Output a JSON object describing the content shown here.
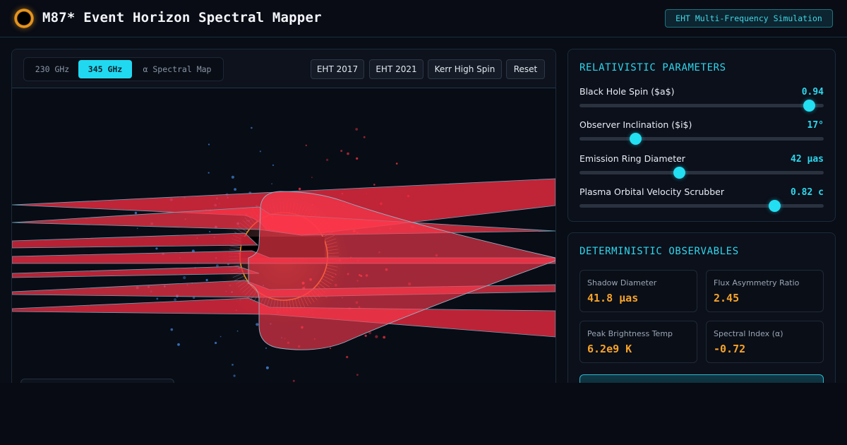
{
  "header": {
    "title": "M87* Event Horizon Spectral Mapper",
    "badge": "EHT Multi-Frequency Simulation"
  },
  "viz": {
    "freq_tabs": [
      {
        "label": "230 GHz",
        "active": false
      },
      {
        "label": "345 GHz",
        "active": true
      },
      {
        "label": "α Spectral Map",
        "active": false
      }
    ],
    "presets": [
      "EHT 2017",
      "EHT 2021",
      "Kerr High Spin",
      "Reset"
    ]
  },
  "parameters": {
    "title": "RELATIVISTIC PARAMETERS",
    "items": [
      {
        "label": "Black Hole Spin ($a$)",
        "value": "0.94",
        "level": 0.94
      },
      {
        "label": "Observer Inclination ($i$)",
        "value": "17°",
        "level": 0.23
      },
      {
        "label": "Emission Ring Diameter",
        "value": "42 μas",
        "level": 0.41
      },
      {
        "label": "Plasma Orbital Velocity Scrubber",
        "value": "0.82 c",
        "level": 0.8
      }
    ]
  },
  "observables": {
    "title": "DETERMINISTIC OBSERVABLES",
    "items": [
      {
        "label": "Shadow Diameter",
        "value": "41.8 μas"
      },
      {
        "label": "Flux Asymmetry Ratio",
        "value": "2.45"
      },
      {
        "label": "Peak Brightness Temp",
        "value": "6.2e9 K"
      },
      {
        "label": "Spectral Index (α)",
        "value": "-0.72"
      }
    ]
  },
  "colors": {
    "accent": "#20d9f1",
    "observable": "#f5a329",
    "plasma": "#ff3a4e",
    "ring": "#e6941e"
  }
}
